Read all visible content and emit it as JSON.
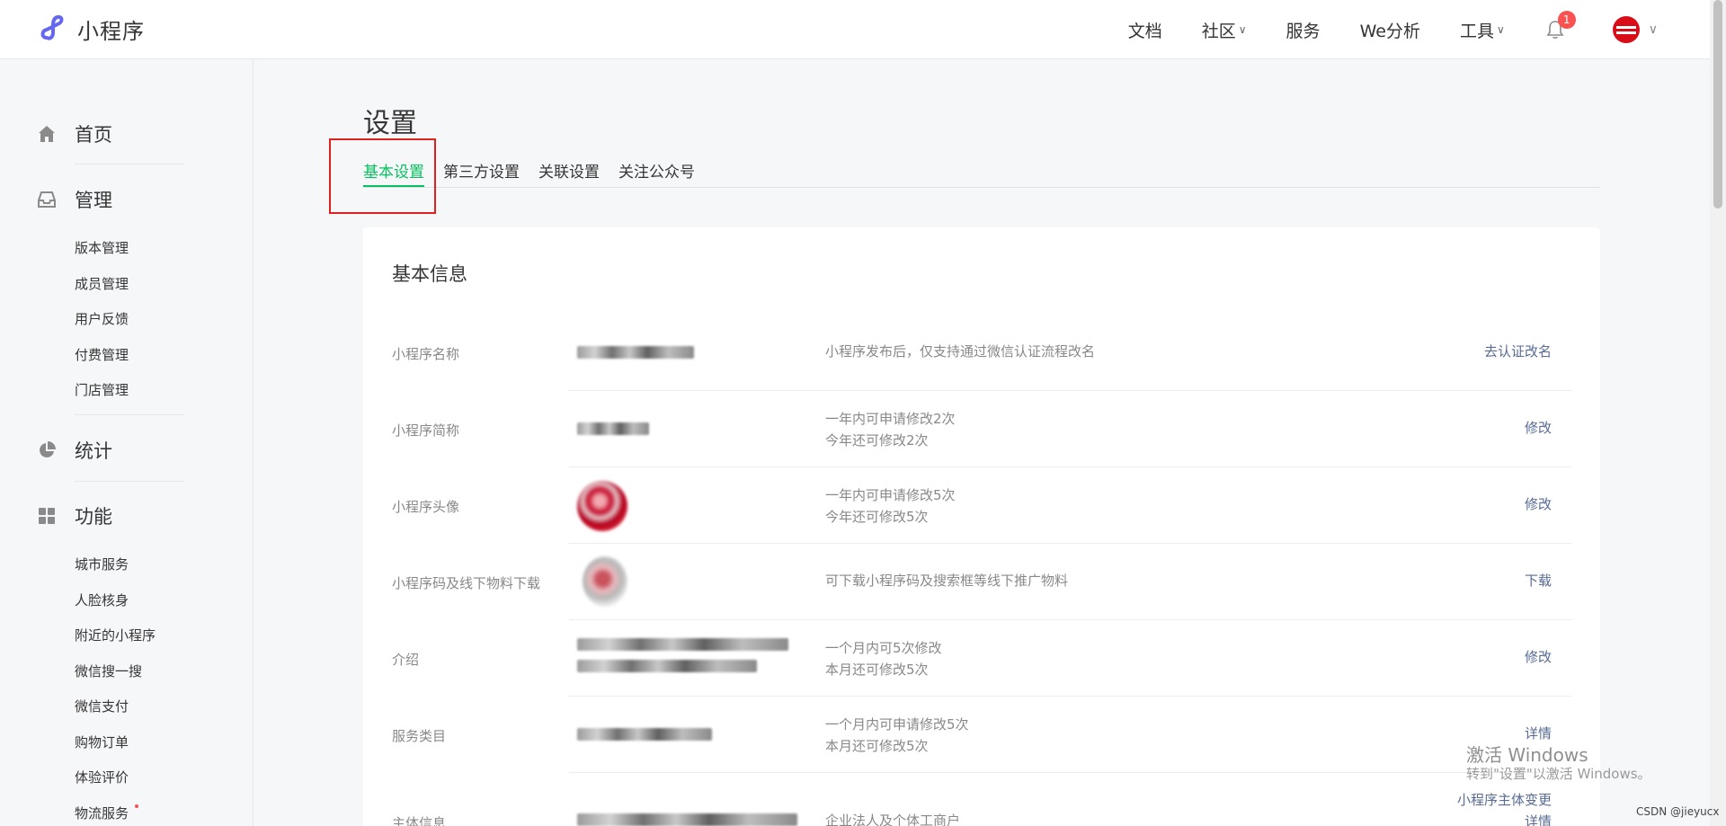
{
  "header": {
    "app_name": "小程序",
    "nav": [
      "文档",
      "社区",
      "服务",
      "We分析",
      "工具"
    ],
    "nav_dropdown": [
      false,
      true,
      false,
      false,
      true
    ],
    "notification_count": "1",
    "brand_color": "#07c160"
  },
  "sidebar": {
    "home": "首页",
    "manage": "管理",
    "manage_items": [
      "版本管理",
      "成员管理",
      "用户反馈",
      "付费管理",
      "门店管理"
    ],
    "stats": "统计",
    "features": "功能",
    "feature_items": [
      "城市服务",
      "人脸核身",
      "附近的小程序",
      "微信搜一搜",
      "微信支付",
      "购物订单",
      "体验评价",
      "物流服务"
    ]
  },
  "main": {
    "title": "设置",
    "tabs": [
      "基本设置",
      "第三方设置",
      "关联设置",
      "关注公众号"
    ],
    "active_tab": "基本设置",
    "section_title": "基本信息",
    "rows": [
      {
        "label": "小程序名称",
        "desc": [
          "小程序发布后，仅支持通过微信认证流程改名"
        ],
        "action": [
          "去认证改名"
        ]
      },
      {
        "label": "小程序简称",
        "desc": [
          "一年内可申请修改2次",
          "今年还可修改2次"
        ],
        "action": [
          "修改"
        ]
      },
      {
        "label": "小程序头像",
        "desc": [
          "一年内可申请修改5次",
          "今年还可修改5次"
        ],
        "action": [
          "修改"
        ]
      },
      {
        "label": "小程序码及线下物料下载",
        "desc": [
          "可下载小程序码及搜索框等线下推广物料"
        ],
        "action": [
          "下载"
        ]
      },
      {
        "label": "介绍",
        "desc": [
          "一个月内可5次修改",
          "本月还可修改5次"
        ],
        "action": [
          "修改"
        ]
      },
      {
        "label": "服务类目",
        "desc": [
          "一个月内可申请修改5次",
          "本月还可修改5次"
        ],
        "action": [
          "详情"
        ]
      },
      {
        "label": "主体信息",
        "desc": [
          "企业法人及个体工商户"
        ],
        "action": [
          "小程序主体变更",
          "详情"
        ]
      }
    ]
  },
  "watermark": {
    "line1": "激活 Windows",
    "line2": "转到\"设置\"以激活 Windows。"
  },
  "credit": "CSDN @jieyucx"
}
